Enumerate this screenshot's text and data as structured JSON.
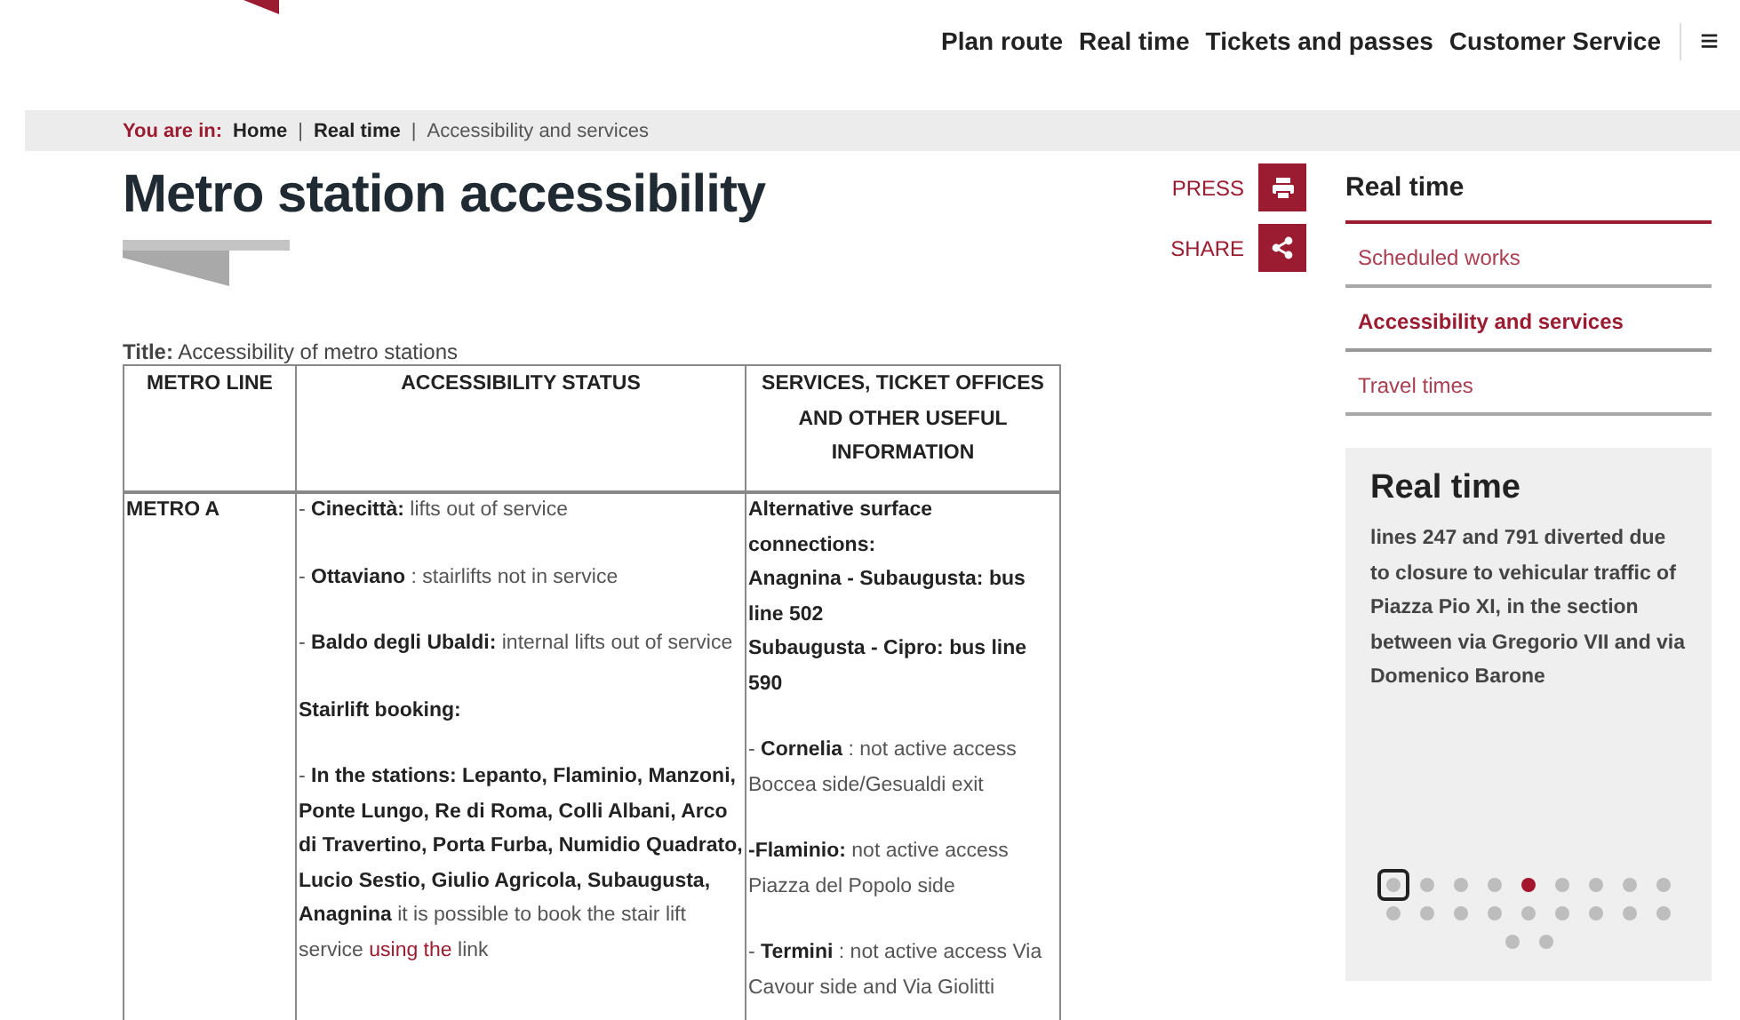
{
  "header": {
    "nav": [
      "Plan route",
      "Real time",
      "Tickets and passes",
      "Customer Service"
    ],
    "menu_glyph": "≡"
  },
  "breadcrumb": {
    "label": "You are in:",
    "separator": "|",
    "items": [
      {
        "text": "Home",
        "current": false
      },
      {
        "text": "Real time",
        "current": false
      },
      {
        "text": "Accessibility and services",
        "current": true
      }
    ]
  },
  "page_title": "Metro station accessibility",
  "actions": [
    {
      "label": "PRESS",
      "kind": "print"
    },
    {
      "label": "SHARE",
      "kind": "share"
    }
  ],
  "table": {
    "caption_label": "Title:",
    "caption": "Accessibility of metro stations",
    "columns": [
      "METRO LINE",
      "ACCESSIBILITY STATUS",
      "SERVICES, TICKET OFFICES AND OTHER USEFUL INFORMATION"
    ],
    "rows": [
      {
        "line": "METRO A",
        "status": [
          {
            "text": "- **Cinecittà:** lifts out of service"
          },
          {
            "text": "- **Ottaviano** : stairlifts not in service"
          },
          {
            "text": "- **Baldo degli Ubaldi:** internal lifts out of service"
          },
          {
            "text": "**Stairlift booking:**"
          },
          {
            "text": "- **In the stations: Lepanto, Flaminio, Manzoni, Ponte Lungo, Re di Roma, Colli Albani, Arco di Travertino, Porta Furba, Numidio Quadrato, Lucio Sestio, Giulio Agricola, Subaugusta, Anagnina**  it is possible to book the stair lift service ",
            "link": "using the",
            "after": " link"
          }
        ],
        "info": [
          {
            "text": "**Alternative surface connections:**\n**Anagnina - Subaugusta: bus line 502**\n**Subaugusta - Cipro: bus line 590**"
          },
          {
            "text": "- **Cornelia** : not active access Boccea side/Gesualdi exit"
          },
          {
            "text": "**-Flaminio:**  not active access Piazza del Popolo side"
          },
          {
            "text": "- **Termini** : not active access Via Cavour side and Via Giolitti"
          }
        ]
      }
    ]
  },
  "sidebar": {
    "title": "Real time",
    "items": [
      {
        "label": "Scheduled works",
        "selected": false
      },
      {
        "label": "Accessibility and services",
        "selected": true
      },
      {
        "label": "Travel times",
        "selected": false
      }
    ]
  },
  "news": {
    "title": "Real time",
    "text": "lines 247 and 791 diverted due to closure to vehicular traffic of Piazza Pio XI, in the section between via Gregorio VII and via Domenico Barone",
    "dots": [
      {
        "selected": false,
        "focused": true
      },
      {
        "selected": false,
        "focused": false
      },
      {
        "selected": false,
        "focused": false
      },
      {
        "selected": false,
        "focused": false
      },
      {
        "selected": true,
        "focused": false
      },
      {
        "selected": false,
        "focused": false
      },
      {
        "selected": false,
        "focused": false
      },
      {
        "selected": false,
        "focused": false
      },
      {
        "selected": false,
        "focused": false
      },
      {
        "selected": false,
        "focused": false
      },
      {
        "selected": false,
        "focused": false
      },
      {
        "selected": false,
        "focused": false
      },
      {
        "selected": false,
        "focused": false
      },
      {
        "selected": false,
        "focused": false
      },
      {
        "selected": false,
        "focused": false
      },
      {
        "selected": false,
        "focused": false
      },
      {
        "selected": false,
        "focused": false
      },
      {
        "selected": false,
        "focused": false
      },
      {
        "selected": false,
        "focused": false
      },
      {
        "selected": false,
        "focused": false
      }
    ]
  }
}
